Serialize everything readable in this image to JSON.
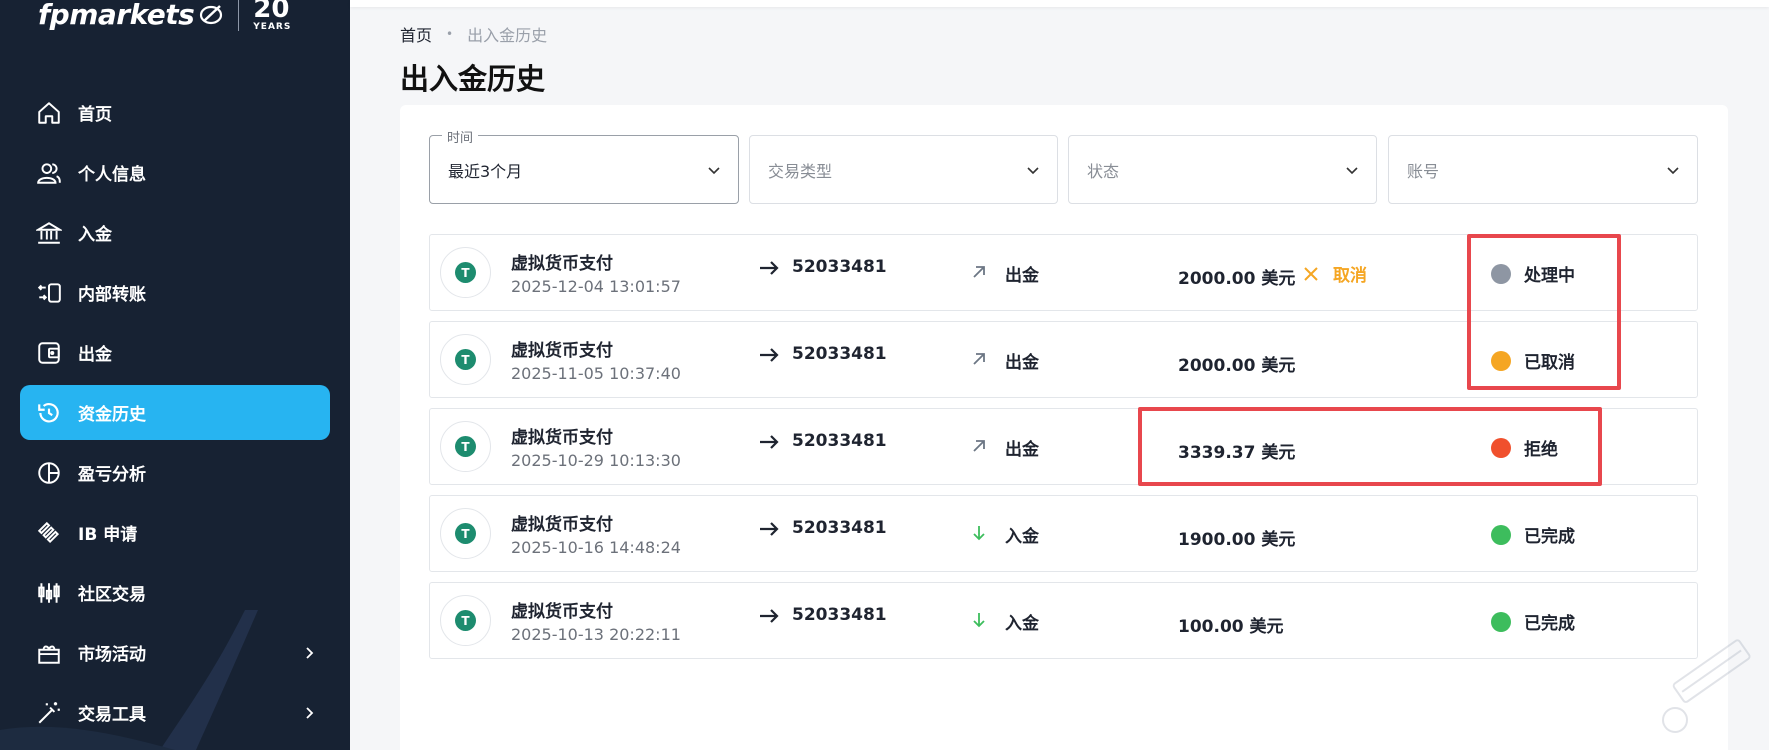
{
  "brand": {
    "name": "fpmarkets",
    "years_num": "20",
    "years_label": "YEARS"
  },
  "sidebar": {
    "items": [
      {
        "label": "首页",
        "icon": "home-icon"
      },
      {
        "label": "个人信息",
        "icon": "user-icon"
      },
      {
        "label": "入金",
        "icon": "bank-icon"
      },
      {
        "label": "内部转账",
        "icon": "transfer-icon"
      },
      {
        "label": "出金",
        "icon": "wallet-icon"
      },
      {
        "label": "资金历史",
        "icon": "history-icon",
        "active": true
      },
      {
        "label": "盈亏分析",
        "icon": "pie-chart-icon"
      },
      {
        "label": "IB 申请",
        "icon": "ib-icon"
      },
      {
        "label": "社区交易",
        "icon": "candlestick-icon"
      },
      {
        "label": "市场活动",
        "icon": "gift-icon",
        "has_submenu": true
      },
      {
        "label": "交易工具",
        "icon": "magic-wand-icon",
        "has_submenu": true
      }
    ]
  },
  "breadcrumb": {
    "home": "首页",
    "separator": "•",
    "current": "出入金历史"
  },
  "page": {
    "title": "出入金历史"
  },
  "filters": {
    "time": {
      "legend": "时间",
      "value": "最近3个月"
    },
    "type": {
      "placeholder": "交易类型"
    },
    "status": {
      "placeholder": "状态"
    },
    "account": {
      "placeholder": "账号"
    }
  },
  "rows": [
    {
      "method": "虚拟货币支付",
      "datetime": "2025-12-04 13:01:57",
      "account": "52033481",
      "type": "出金",
      "direction": "out",
      "amount": "2000.00 美元",
      "cancel_label": "取消",
      "status": "处理中",
      "status_color": "#8e96a3"
    },
    {
      "method": "虚拟货币支付",
      "datetime": "2025-11-05 10:37:40",
      "account": "52033481",
      "type": "出金",
      "direction": "out",
      "amount": "2000.00 美元",
      "status": "已取消",
      "status_color": "#f5a623"
    },
    {
      "method": "虚拟货币支付",
      "datetime": "2025-10-29 10:13:30",
      "account": "52033481",
      "type": "出金",
      "direction": "out",
      "amount": "3339.37 美元",
      "status": "拒绝",
      "status_color": "#f0502d"
    },
    {
      "method": "虚拟货币支付",
      "datetime": "2025-10-16 14:48:24",
      "account": "52033481",
      "type": "入金",
      "direction": "in",
      "amount": "1900.00 美元",
      "status": "已完成",
      "status_color": "#3dbd5d"
    },
    {
      "method": "虚拟货币支付",
      "datetime": "2025-10-13 20:22:11",
      "account": "52033481",
      "type": "入金",
      "direction": "in",
      "amount": "100.00 美元",
      "status": "已完成",
      "status_color": "#3dbd5d"
    }
  ],
  "coin_symbol": "T",
  "colors": {
    "sidebar_bg": "#172233",
    "active_nav": "#27b4f1",
    "cancel": "#f5a623",
    "annotation": "#e8474d",
    "in_arrow": "#3dbd5d",
    "out_arrow": "#6c7684"
  }
}
